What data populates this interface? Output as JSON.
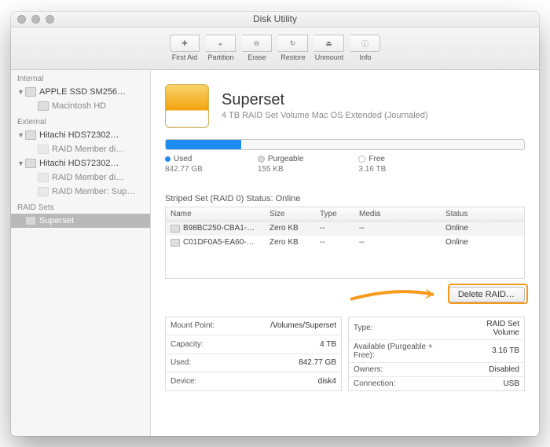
{
  "window": {
    "title": "Disk Utility"
  },
  "toolbar": [
    {
      "label": "First Aid",
      "glyph": "✚"
    },
    {
      "label": "Partition",
      "glyph": "◒"
    },
    {
      "label": "Erase",
      "glyph": "⊖"
    },
    {
      "label": "Restore",
      "glyph": "↻"
    },
    {
      "label": "Unmount",
      "glyph": "⏏"
    },
    {
      "label": "Info",
      "glyph": "ⓘ"
    }
  ],
  "sidebar": {
    "sections": [
      {
        "title": "Internal",
        "items": [
          {
            "label": "APPLE SSD SM256…",
            "expandable": true,
            "children": [
              {
                "label": "Macintosh HD"
              }
            ]
          }
        ]
      },
      {
        "title": "External",
        "items": [
          {
            "label": "Hitachi HDS72302…",
            "expandable": true,
            "children": [
              {
                "label": "RAID Member di…",
                "dim": true
              }
            ]
          },
          {
            "label": "Hitachi HDS72302…",
            "expandable": true,
            "children": [
              {
                "label": "RAID Member di…",
                "dim": true
              },
              {
                "label": "RAID Member: Sup…",
                "dim": true
              }
            ]
          }
        ]
      },
      {
        "title": "RAID Sets",
        "items": [
          {
            "label": "Superset",
            "selected": true
          }
        ]
      }
    ]
  },
  "volume": {
    "name": "Superset",
    "subtitle": "4 TB RAID Set Volume Mac OS Extended (Journaled)",
    "usage_percent": 21,
    "legend": {
      "used": {
        "label": "Used",
        "value": "842.77 GB"
      },
      "purge": {
        "label": "Purgeable",
        "value": "155 KB"
      },
      "free": {
        "label": "Free",
        "value": "3.16 TB"
      }
    }
  },
  "raid": {
    "status_line": "Striped Set (RAID 0) Status: Online",
    "columns": {
      "name": "Name",
      "size": "Size",
      "type": "Type",
      "media": "Media",
      "status": "Status"
    },
    "members": [
      {
        "name": "B98BC250-CBA1-…",
        "size": "Zero KB",
        "type": "--",
        "media": "--",
        "status": "Online"
      },
      {
        "name": "C01DF0A5-EA60-…",
        "size": "Zero KB",
        "type": "--",
        "media": "--",
        "status": "Online"
      }
    ],
    "delete_button": "Delete RAID…"
  },
  "details": {
    "left": [
      {
        "k": "Mount Point:",
        "v": "/Volumes/Superset"
      },
      {
        "k": "Capacity:",
        "v": "4 TB"
      },
      {
        "k": "Used:",
        "v": "842.77 GB"
      },
      {
        "k": "Device:",
        "v": "disk4"
      }
    ],
    "right": [
      {
        "k": "Type:",
        "v": "RAID Set Volume"
      },
      {
        "k": "Available (Purgeable + Free):",
        "v": "3.16 TB"
      },
      {
        "k": "Owners:",
        "v": "Disabled"
      },
      {
        "k": "Connection:",
        "v": "USB"
      }
    ]
  },
  "annotation_color": "#f79a1a"
}
